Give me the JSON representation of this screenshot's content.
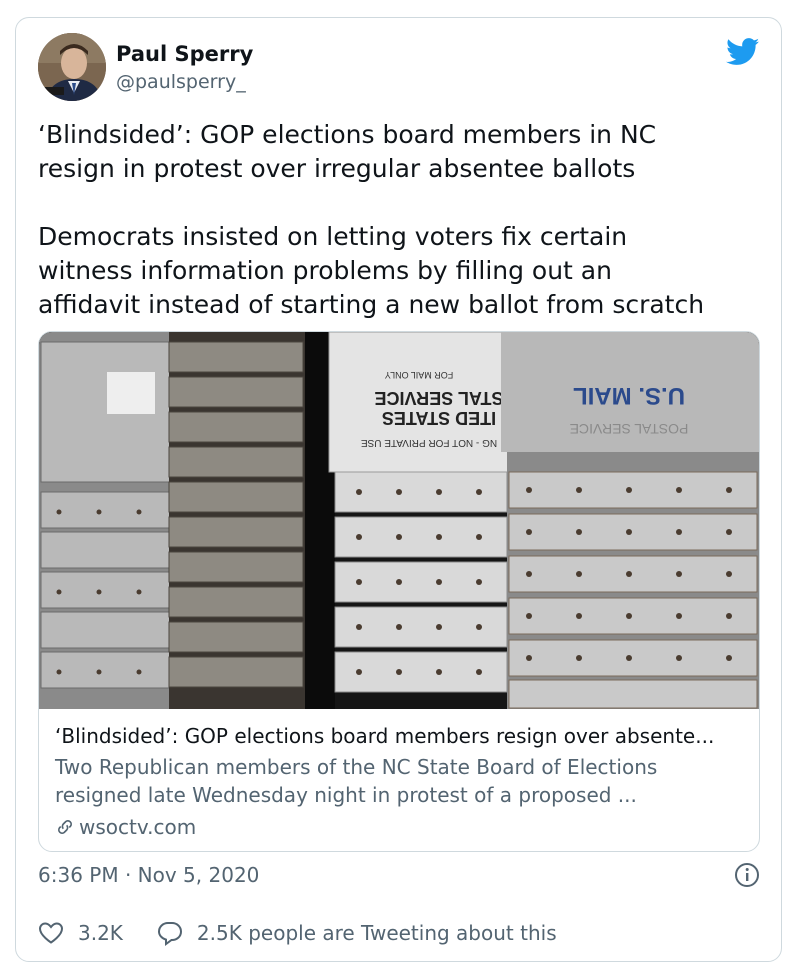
{
  "author": {
    "display_name": "Paul Sperry",
    "handle": "@paulsperry_"
  },
  "tweet": {
    "text": "‘Blindsided’: GOP elections board members in NC\nresign in protest over irregular absentee ballots\n\nDemocrats insisted on letting voters fix certain\nwitness information problems by filling out an\naffidavit instead of starting a new ballot from scratch",
    "timestamp": "6:36 PM · Nov 5, 2020"
  },
  "link_card": {
    "title": "‘Blindsided’: GOP elections board members resign over absente...",
    "description": "Two Republican members of the NC State Board of Elections resigned late Wednesday night in protest of a proposed ...",
    "domain": "wsoctv.com",
    "image_text": {
      "mail_label": "U.S. MAIL",
      "for_mail_only": "FOR MAIL ONLY",
      "postal_service": "POSTAL SERVICE",
      "united_states": "ITED STATES",
      "not_private": "NG - NOT FOR PRIVATE USE",
      "postal_service_upper": "STAL SERVICE"
    }
  },
  "actions": {
    "likes": "3.2K",
    "tweeting": "2.5K people are Tweeting about this"
  },
  "colors": {
    "twitter_blue": "#1d9bf0",
    "secondary_text": "#536471",
    "border": "#cfd9de"
  },
  "icons": [
    "twitter-bird-icon",
    "link-icon",
    "info-icon",
    "heart-icon",
    "speech-bubble-icon"
  ]
}
